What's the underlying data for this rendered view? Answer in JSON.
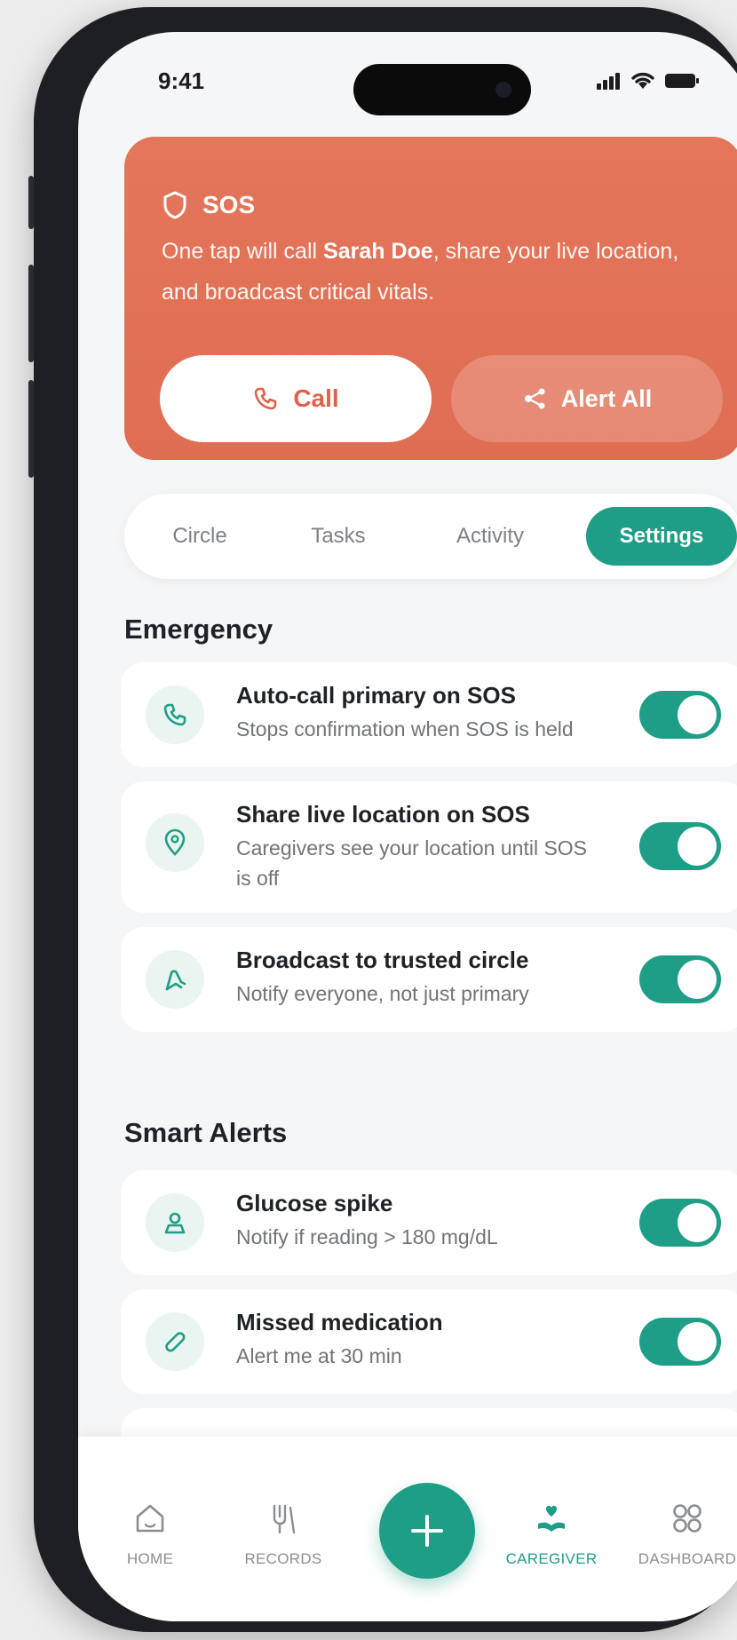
{
  "status_bar": {
    "time": "9:41"
  },
  "sos": {
    "title": "SOS",
    "desc_prefix": "One tap will call ",
    "contact": "Sarah Doe",
    "desc_suffix": ", share your live location, and broadcast critical vitals.",
    "call_label": "Call",
    "alert_label": "Alert All"
  },
  "tabs": [
    "Circle",
    "Tasks",
    "Activity",
    "Settings"
  ],
  "active_tab": "Settings",
  "sections": {
    "emergency": {
      "title": "Emergency",
      "items": [
        {
          "title": "Auto-call primary on SOS",
          "subtitle": "Stops confirmation when SOS is held",
          "icon": "phone-icon",
          "enabled": true
        },
        {
          "title": "Share live location on SOS",
          "subtitle": "Caregivers see your location until SOS is off",
          "icon": "location-pin-icon",
          "enabled": true
        },
        {
          "title": "Broadcast to trusted circle",
          "subtitle": "Notify everyone, not just primary",
          "icon": "broadcast-icon",
          "enabled": true
        }
      ]
    },
    "smart_alerts": {
      "title": "Smart Alerts",
      "items": [
        {
          "title": "Glucose spike",
          "subtitle": "Notify if reading > 180 mg/dL",
          "icon": "glucose-icon",
          "enabled": true
        },
        {
          "title": "Missed medication",
          "subtitle": "Alert me at 30 min",
          "icon": "pill-icon",
          "enabled": true
        }
      ]
    }
  },
  "nav": {
    "home": "HOME",
    "records": "RECORDS",
    "caregiver": "CAREGIVER",
    "dashboard": "DASHBOARD"
  },
  "colors": {
    "accent": "#1e9e86",
    "sos": "#e0694f",
    "background": "#f5f6f7"
  }
}
